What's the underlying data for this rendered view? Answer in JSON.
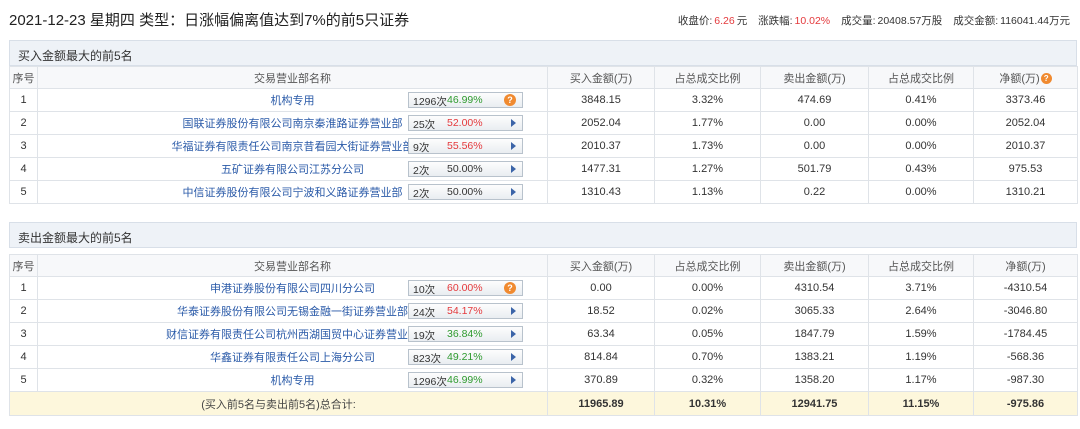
{
  "header": {
    "title": "2021-12-23 星期四 类型：日涨幅偏离值达到7%的前5只证券",
    "close_label": "收盘价:",
    "close_value": "6.26",
    "close_unit": "元",
    "change_label": "涨跌幅:",
    "change_value": "10.02%",
    "volume_label": "成交量:",
    "volume_value": "20408.57万股",
    "amount_label": "成交金额:",
    "amount_value": "116041.44万元"
  },
  "buy_section": {
    "title": "买入金额最大的前5名",
    "columns": [
      "序号",
      "交易营业部名称",
      "买入金额(万)",
      "占总成交比例",
      "卖出金额(万)",
      "占总成交比例",
      "净额(万)"
    ],
    "rows": [
      {
        "no": "1",
        "name": "机构专用",
        "count": "1296次",
        "pct": "46.99%",
        "pct_color": "green",
        "icon": "question-icon",
        "buy": "3848.15",
        "buy_ratio": "3.32%",
        "sell": "474.69",
        "sell_ratio": "0.41%",
        "net": "3373.46"
      },
      {
        "no": "2",
        "name": "国联证券股份有限公司南京秦淮路证券营业部",
        "count": "25次",
        "pct": "52.00%",
        "pct_color": "red",
        "icon": "arrow-right-icon",
        "buy": "2052.04",
        "buy_ratio": "1.77%",
        "sell": "0.00",
        "sell_ratio": "0.00%",
        "net": "2052.04"
      },
      {
        "no": "3",
        "name": "华福证券有限责任公司南京昔看园大街证券营业部",
        "count": "9次",
        "pct": "55.56%",
        "pct_color": "red",
        "icon": "arrow-right-icon",
        "buy": "2010.37",
        "buy_ratio": "1.73%",
        "sell": "0.00",
        "sell_ratio": "0.00%",
        "net": "2010.37"
      },
      {
        "no": "4",
        "name": "五矿证券有限公司江苏分公司",
        "count": "2次",
        "pct": "50.00%",
        "pct_color": "plain",
        "icon": "arrow-right-icon",
        "buy": "1477.31",
        "buy_ratio": "1.27%",
        "sell": "501.79",
        "sell_ratio": "0.43%",
        "net": "975.53"
      },
      {
        "no": "5",
        "name": "中信证券股份有限公司宁波和义路证券营业部",
        "count": "2次",
        "pct": "50.00%",
        "pct_color": "plain",
        "icon": "arrow-right-icon",
        "buy": "1310.43",
        "buy_ratio": "1.13%",
        "sell": "0.22",
        "sell_ratio": "0.00%",
        "net": "1310.21"
      }
    ]
  },
  "sell_section": {
    "title": "卖出金额最大的前5名",
    "columns": [
      "序号",
      "交易营业部名称",
      "买入金额(万)",
      "占总成交比例",
      "卖出金额(万)",
      "占总成交比例",
      "净额(万)"
    ],
    "rows": [
      {
        "no": "1",
        "name": "申港证券股份有限公司四川分公司",
        "count": "10次",
        "pct": "60.00%",
        "pct_color": "red",
        "icon": "question-icon",
        "buy": "0.00",
        "buy_ratio": "0.00%",
        "sell": "4310.54",
        "sell_ratio": "3.71%",
        "net": "-4310.54"
      },
      {
        "no": "2",
        "name": "华泰证券股份有限公司无锡金融一街证券营业部",
        "count": "24次",
        "pct": "54.17%",
        "pct_color": "red",
        "icon": "arrow-right-icon",
        "buy": "18.52",
        "buy_ratio": "0.02%",
        "sell": "3065.33",
        "sell_ratio": "2.64%",
        "net": "-3046.80"
      },
      {
        "no": "3",
        "name": "财信证券有限责任公司杭州西湖国贸中心证券营业部",
        "count": "19次",
        "pct": "36.84%",
        "pct_color": "green",
        "icon": "arrow-right-icon",
        "buy": "63.34",
        "buy_ratio": "0.05%",
        "sell": "1847.79",
        "sell_ratio": "1.59%",
        "net": "-1784.45"
      },
      {
        "no": "4",
        "name": "华鑫证券有限责任公司上海分公司",
        "count": "823次",
        "pct": "49.21%",
        "pct_color": "green",
        "icon": "arrow-right-icon",
        "buy": "814.84",
        "buy_ratio": "0.70%",
        "sell": "1383.21",
        "sell_ratio": "1.19%",
        "net": "-568.36"
      },
      {
        "no": "5",
        "name": "机构专用",
        "count": "1296次",
        "pct": "46.99%",
        "pct_color": "green",
        "icon": "arrow-right-icon",
        "buy": "370.89",
        "buy_ratio": "0.32%",
        "sell": "1358.20",
        "sell_ratio": "1.17%",
        "net": "-987.30"
      }
    ],
    "total": {
      "label": "(买入前5名与卖出前5名)总合计:",
      "buy": "11965.89",
      "buy_ratio": "10.31%",
      "sell": "12941.75",
      "sell_ratio": "11.15%",
      "net": "-975.86"
    }
  },
  "colors": {
    "up": "#e4393c",
    "down": "#2e9a2e",
    "link": "#2a5aa8",
    "icon_orange": "#f08a30"
  }
}
